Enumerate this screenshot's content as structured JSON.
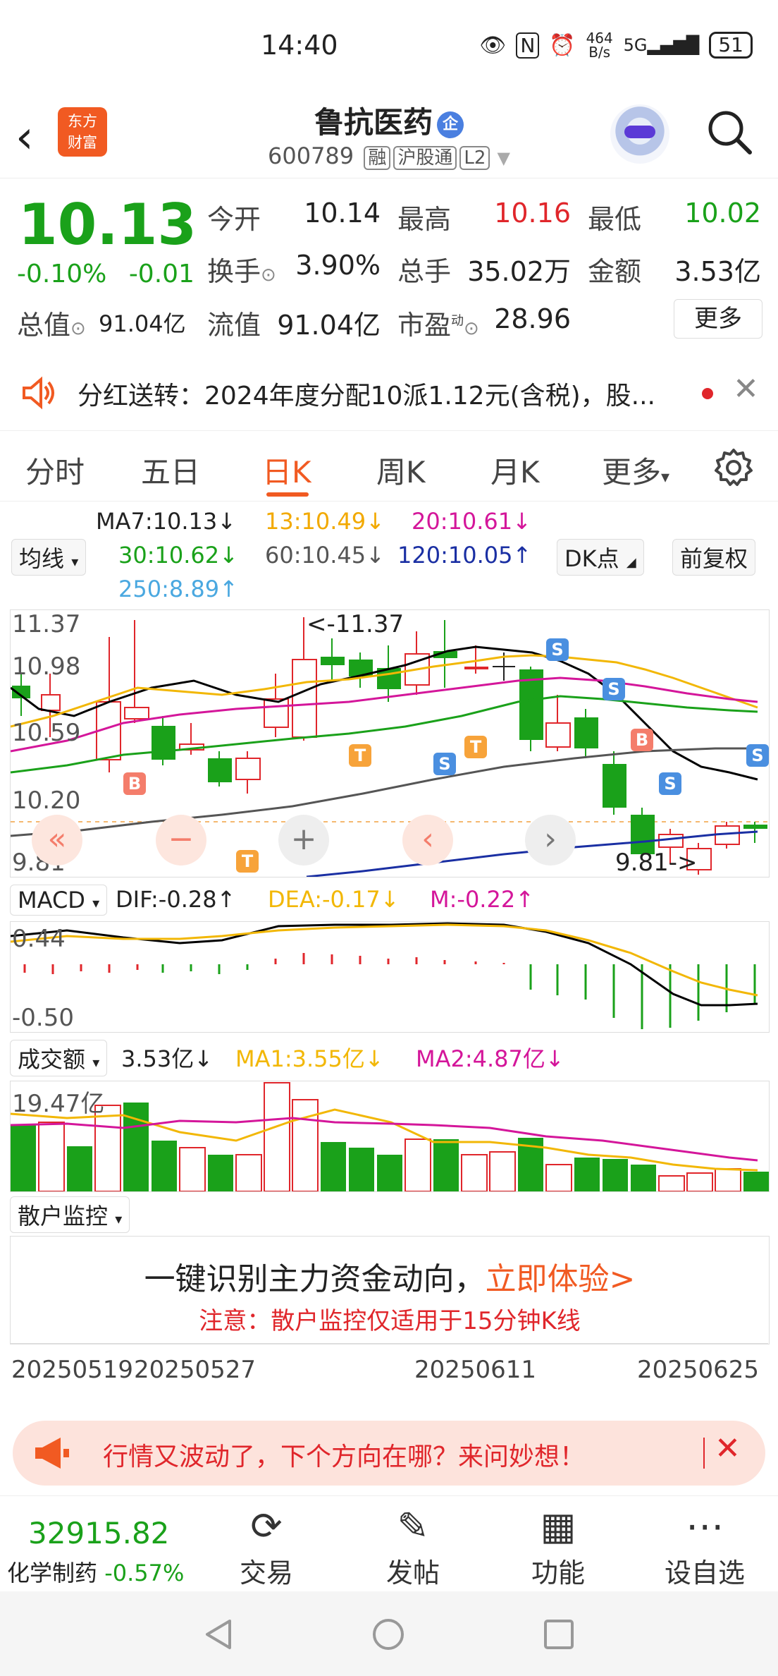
{
  "status_bar": {
    "time": "14:40",
    "net_speed": "464 B/s",
    "signal": "5G",
    "battery": "51"
  },
  "header": {
    "app_logo": "东方财富",
    "stock_name": "鲁抗医药",
    "badge": "企",
    "code": "600789",
    "tags": [
      "融",
      "沪股通",
      "L2"
    ]
  },
  "quote": {
    "price": "10.13",
    "change_pct": "-0.10%",
    "change": "-0.01",
    "fields": [
      {
        "label": "今开",
        "value": "10.14"
      },
      {
        "label": "最高",
        "value": "10.16"
      },
      {
        "label": "最低",
        "value": "10.02"
      },
      {
        "label": "换手",
        "value": "3.90%"
      },
      {
        "label": "总手",
        "value": "35.02万"
      },
      {
        "label": "金额",
        "value": "3.53亿"
      },
      {
        "label": "总值",
        "value": "91.04亿"
      },
      {
        "label": "流值",
        "value": "91.04亿"
      },
      {
        "label": "市盈",
        "value": "28.96",
        "sup": "动"
      }
    ],
    "more_label": "更多"
  },
  "notice": {
    "text": "分红送转：2024年度分配10派1.12元(含税)，股..."
  },
  "tabs": [
    "分时",
    "五日",
    "日K",
    "周K",
    "月K",
    "更多"
  ],
  "active_tab": "日K",
  "ma": {
    "selector": "均线",
    "ma7": "MA7:10.13↓",
    "ma13": "13:10.49↓",
    "ma20": "20:10.61↓",
    "ma30": "30:10.62↓",
    "ma60": "60:10.45↓",
    "ma120": "120:10.05↑",
    "ma250": "250:8.89↑",
    "dk_label": "DK点",
    "adjust_label": "前复权"
  },
  "kline": {
    "y_labels": [
      "11.37",
      "10.98",
      "10.59",
      "10.20",
      "9.81"
    ],
    "max_marker": "<-11.37",
    "min_marker": "9.81->",
    "colors": {
      "up": "#e0262b",
      "down": "#1aa11a",
      "ma7": "#000000",
      "ma13": "#f2b705",
      "ma20": "#d4169a",
      "ma30": "#1aa11a",
      "ma60": "#555555",
      "ma120": "#1a2fa3"
    }
  },
  "macd": {
    "selector": "MACD",
    "dif": "DIF:-0.28↑",
    "dea": "DEA:-0.17↓",
    "m": "M:-0.22↑",
    "y_top": "0.44",
    "y_bottom": "-0.50"
  },
  "volume": {
    "selector": "成交额",
    "current": "3.53亿↓",
    "ma1": "MA1:3.55亿↓",
    "ma2": "MA2:4.87亿↓",
    "y_top": "19.47亿"
  },
  "retail": {
    "selector": "散户监控",
    "title_prefix": "一键识别主力资金动向，",
    "title_link": "立即体验>",
    "note": "注意：散户监控仅适用于15分钟K线"
  },
  "dates": [
    "20250519",
    "20250527",
    "20250611",
    "20250625"
  ],
  "banner": {
    "text": "行情又波动了，下个方向在哪？来问妙想！"
  },
  "bottom": {
    "index_value": "32915.82",
    "index_name": "化学制药",
    "index_change": "-0.57%",
    "nav": [
      {
        "label": "交易",
        "icon": "yen-swap-icon"
      },
      {
        "label": "发帖",
        "icon": "edit-icon"
      },
      {
        "label": "功能",
        "icon": "grid-icon"
      },
      {
        "label": "设自选",
        "icon": "more-icon"
      }
    ]
  }
}
